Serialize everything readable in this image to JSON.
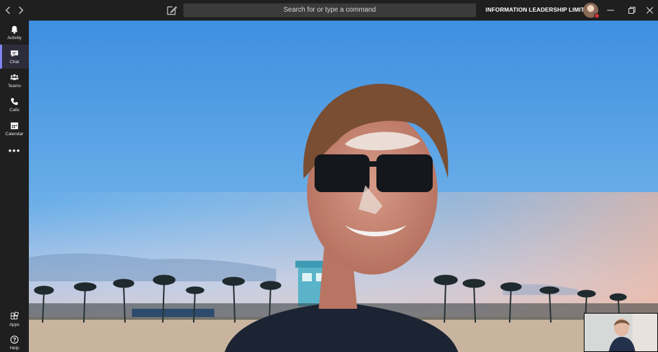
{
  "titlebar": {
    "search_placeholder": "Search for or type a command",
    "tenant_name": "INFORMATION LEADERSHIP LIMITED",
    "icons": {
      "back": "chevron-left-icon",
      "forward": "chevron-right-icon",
      "compose": "compose-icon",
      "minimize": "minimize-icon",
      "restore": "restore-icon",
      "close": "close-icon"
    }
  },
  "rail": {
    "items": [
      {
        "label": "Activity",
        "icon": "bell-icon"
      },
      {
        "label": "Chat",
        "icon": "chat-icon",
        "active": true
      },
      {
        "label": "Teams",
        "icon": "teams-icon"
      },
      {
        "label": "Calls",
        "icon": "phone-icon"
      },
      {
        "label": "Calendar",
        "icon": "calendar-icon"
      }
    ],
    "more": "•••",
    "bottom": [
      {
        "label": "Apps",
        "icon": "apps-icon"
      },
      {
        "label": "Help",
        "icon": "help-icon"
      }
    ]
  },
  "colors": {
    "chrome": "#1f1f1f",
    "search_bg": "#3b3b3b",
    "active_accent": "#7f85f5",
    "presence_busy": "#d13438"
  }
}
